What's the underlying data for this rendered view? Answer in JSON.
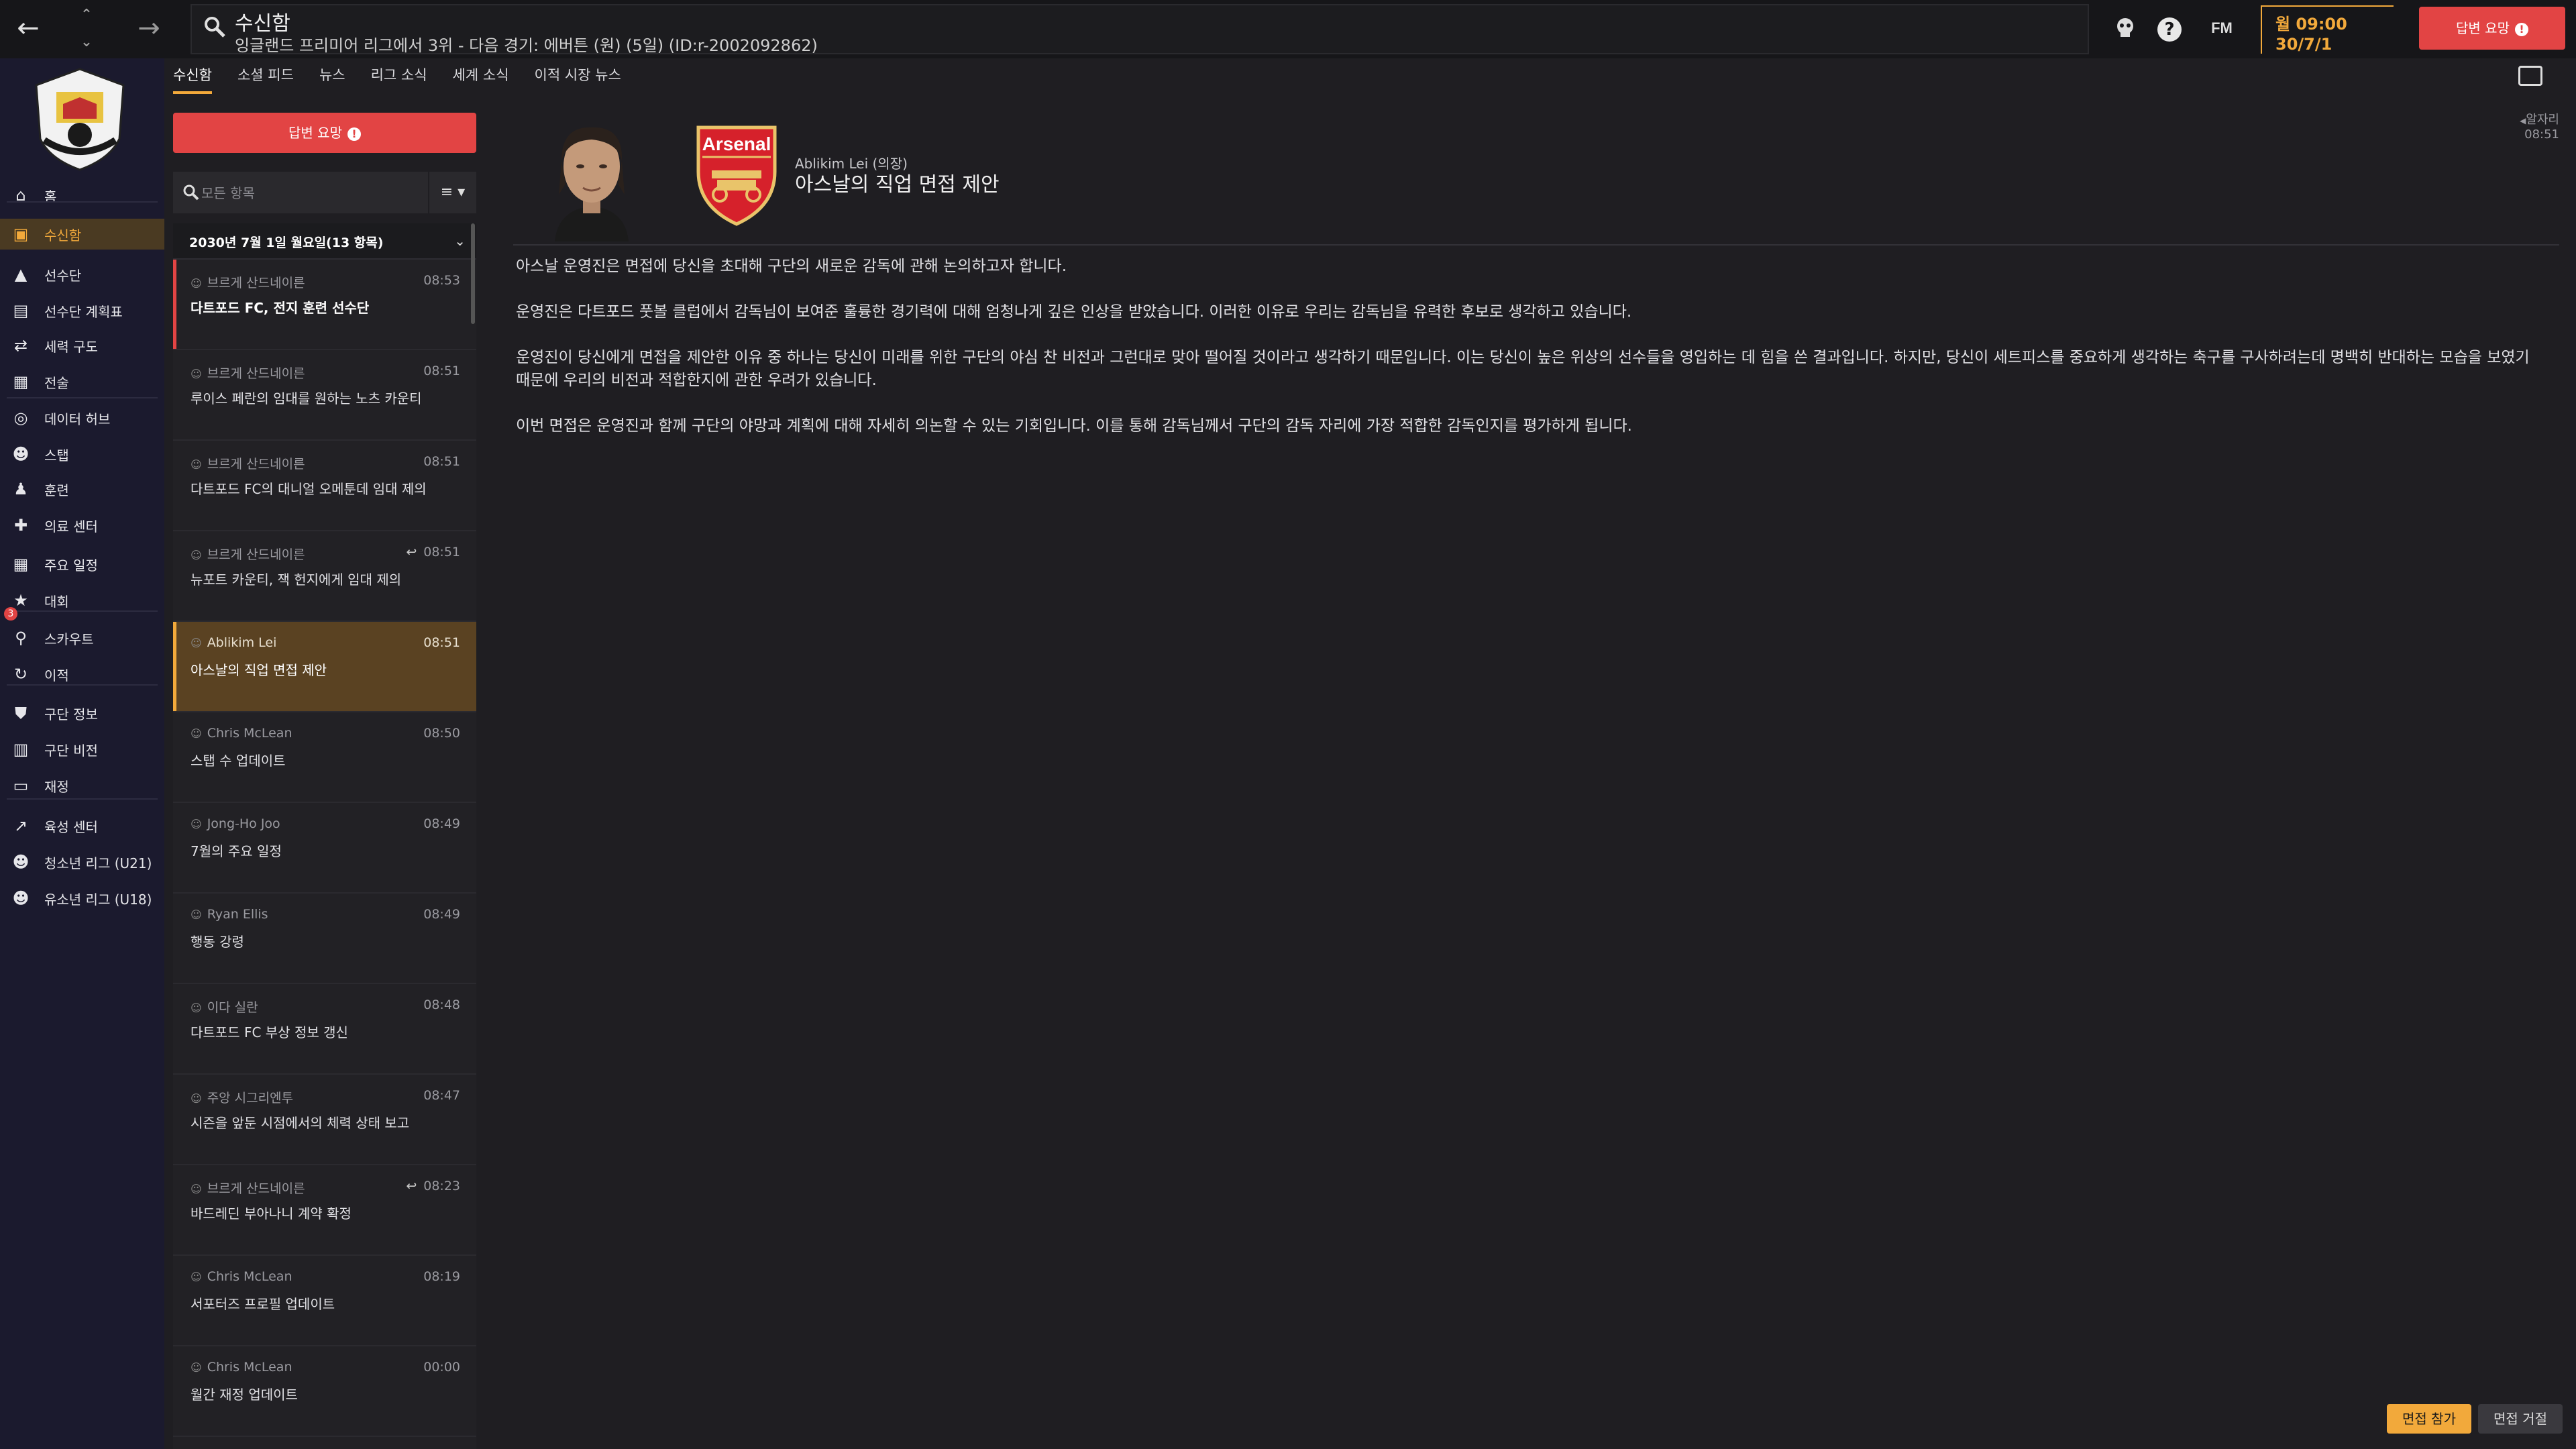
{
  "topbar": {
    "title": "수신함",
    "subtitle": "잉글랜드 프리미어 리그에서 3위 - 다음 경기: 에버튼 (원) (5일) (ID:r-2002092862)",
    "fm_logo": "FM",
    "help": "?",
    "clock_time": "월 09:00",
    "clock_date": "30/7/1",
    "continue_label": "답변 요망"
  },
  "sidebar": {
    "items": [
      {
        "label": "홈",
        "icon": "home-icon"
      },
      {
        "label": "수신함",
        "icon": "inbox-icon"
      },
      {
        "label": "선수단",
        "icon": "shirt-icon"
      },
      {
        "label": "선수단 계획표",
        "icon": "clipboard-icon"
      },
      {
        "label": "세력 구도",
        "icon": "dynamics-icon"
      },
      {
        "label": "전술",
        "icon": "tactics-icon"
      },
      {
        "label": "데이터 허브",
        "icon": "data-hub-icon"
      },
      {
        "label": "스탭",
        "icon": "staff-icon"
      },
      {
        "label": "훈련",
        "icon": "training-icon"
      },
      {
        "label": "의료 센터",
        "icon": "medical-icon"
      },
      {
        "label": "주요 일정",
        "icon": "calendar-icon"
      },
      {
        "label": "대회",
        "icon": "trophy-icon"
      },
      {
        "label": "스카우트",
        "icon": "scout-icon"
      },
      {
        "label": "이적",
        "icon": "transfer-icon"
      },
      {
        "label": "구단 정보",
        "icon": "club-icon"
      },
      {
        "label": "구단 비전",
        "icon": "vision-icon"
      },
      {
        "label": "재정",
        "icon": "finance-icon"
      },
      {
        "label": "육성 센터",
        "icon": "development-icon"
      },
      {
        "label": "청소년 리그 (U21)",
        "icon": "u21-icon"
      },
      {
        "label": "유소년 리그 (U18)",
        "icon": "u18-icon"
      }
    ],
    "transfer_badge": "3"
  },
  "tabs": [
    "수신함",
    "소셜 피드",
    "뉴스",
    "리그 소식",
    "세계 소식",
    "이적 시장 뉴스"
  ],
  "list": {
    "continue_label": "답변 요망",
    "search_placeholder": "모든 항목",
    "filter_label": "≡",
    "date_header": "2030년 7월 1일 월요일(13 항목)",
    "messages": [
      {
        "sender": "브르게 산드네이른",
        "time": "08:53",
        "subject": "다트포드 FC, 전지 훈련 선수단"
      },
      {
        "sender": "브르게 산드네이른",
        "time": "08:51",
        "subject": "루이스 페란의 임대를 원하는 노츠 카운티"
      },
      {
        "sender": "브르게 산드네이른",
        "time": "08:51",
        "subject": "다트포드 FC의 대니얼 오메툰데 임대 제의"
      },
      {
        "sender": "브르게 산드네이른",
        "time": "08:51",
        "subject": "뉴포트 카운티, 잭 헌지에게 임대 제의"
      },
      {
        "sender": "Ablikim Lei",
        "time": "08:51",
        "subject": "아스날의 직업 면접 제안"
      },
      {
        "sender": "Chris McLean",
        "time": "08:50",
        "subject": "스탭 수 업데이트"
      },
      {
        "sender": "Jong-Ho Joo",
        "time": "08:49",
        "subject": "7월의 주요 일정"
      },
      {
        "sender": "Ryan Ellis",
        "time": "08:49",
        "subject": "행동 강령"
      },
      {
        "sender": "이다 실란",
        "time": "08:48",
        "subject": "다트포드 FC 부상 정보 갱신"
      },
      {
        "sender": "주앙 시그리엔투",
        "time": "08:47",
        "subject": "시즌을 앞둔 시점에서의 체력 상태 보고"
      },
      {
        "sender": "브르게 산드네이른",
        "time": "08:23",
        "subject": "바드레딘 부아나니 계약 확정"
      },
      {
        "sender": "Chris McLean",
        "time": "08:19",
        "subject": "서포터즈 프로필 업데이트"
      },
      {
        "sender": "Chris McLean",
        "time": "00:00",
        "subject": "월간 재정 업데이트"
      }
    ]
  },
  "message": {
    "from": "Ablikim Lei (의장)",
    "title": "아스날의 직업 면접 제안",
    "flag_label": "알자리",
    "time": "08:51",
    "club_name": "Arsenal",
    "body": [
      "아스날 운영진은 면접에 당신을 초대해 구단의 새로운 감독에 관해 논의하고자 합니다.",
      "운영진은 다트포드 풋볼 클럽에서 감독님이 보여준 훌륭한 경기력에 대해 엄청나게 깊은 인상을 받았습니다. 이러한 이유로 우리는 감독님을 유력한 후보로 생각하고 있습니다.",
      "운영진이 당신에게 면접을 제안한 이유 중 하나는 당신이 미래를 위한 구단의 야심 찬 비전과 그런대로 맞아 떨어질 것이라고 생각하기 때문입니다. 이는 당신이 높은 위상의 선수들을 영입하는 데 힘을 쓴 결과입니다. 하지만, 당신이 세트피스를 중요하게 생각하는 축구를 구사하려는데 명백히 반대하는 모습을 보였기 때문에 우리의 비전과 적합한지에 관한 우려가 있습니다.",
      "이번 면접은 운영진과 함께 구단의 야망과 계획에 대해 자세히 의논할 수 있는 기회입니다. 이를 통해 감독님께서 구단의 감독 자리에 가장 적합한 감독인지를 평가하게 됩니다."
    ],
    "accept_label": "면접 참가",
    "decline_label": "면접 거절"
  },
  "colors": {
    "accent": "#f2a93b",
    "alert": "#e24444",
    "sidebar_bg": "#1b1a2e"
  }
}
